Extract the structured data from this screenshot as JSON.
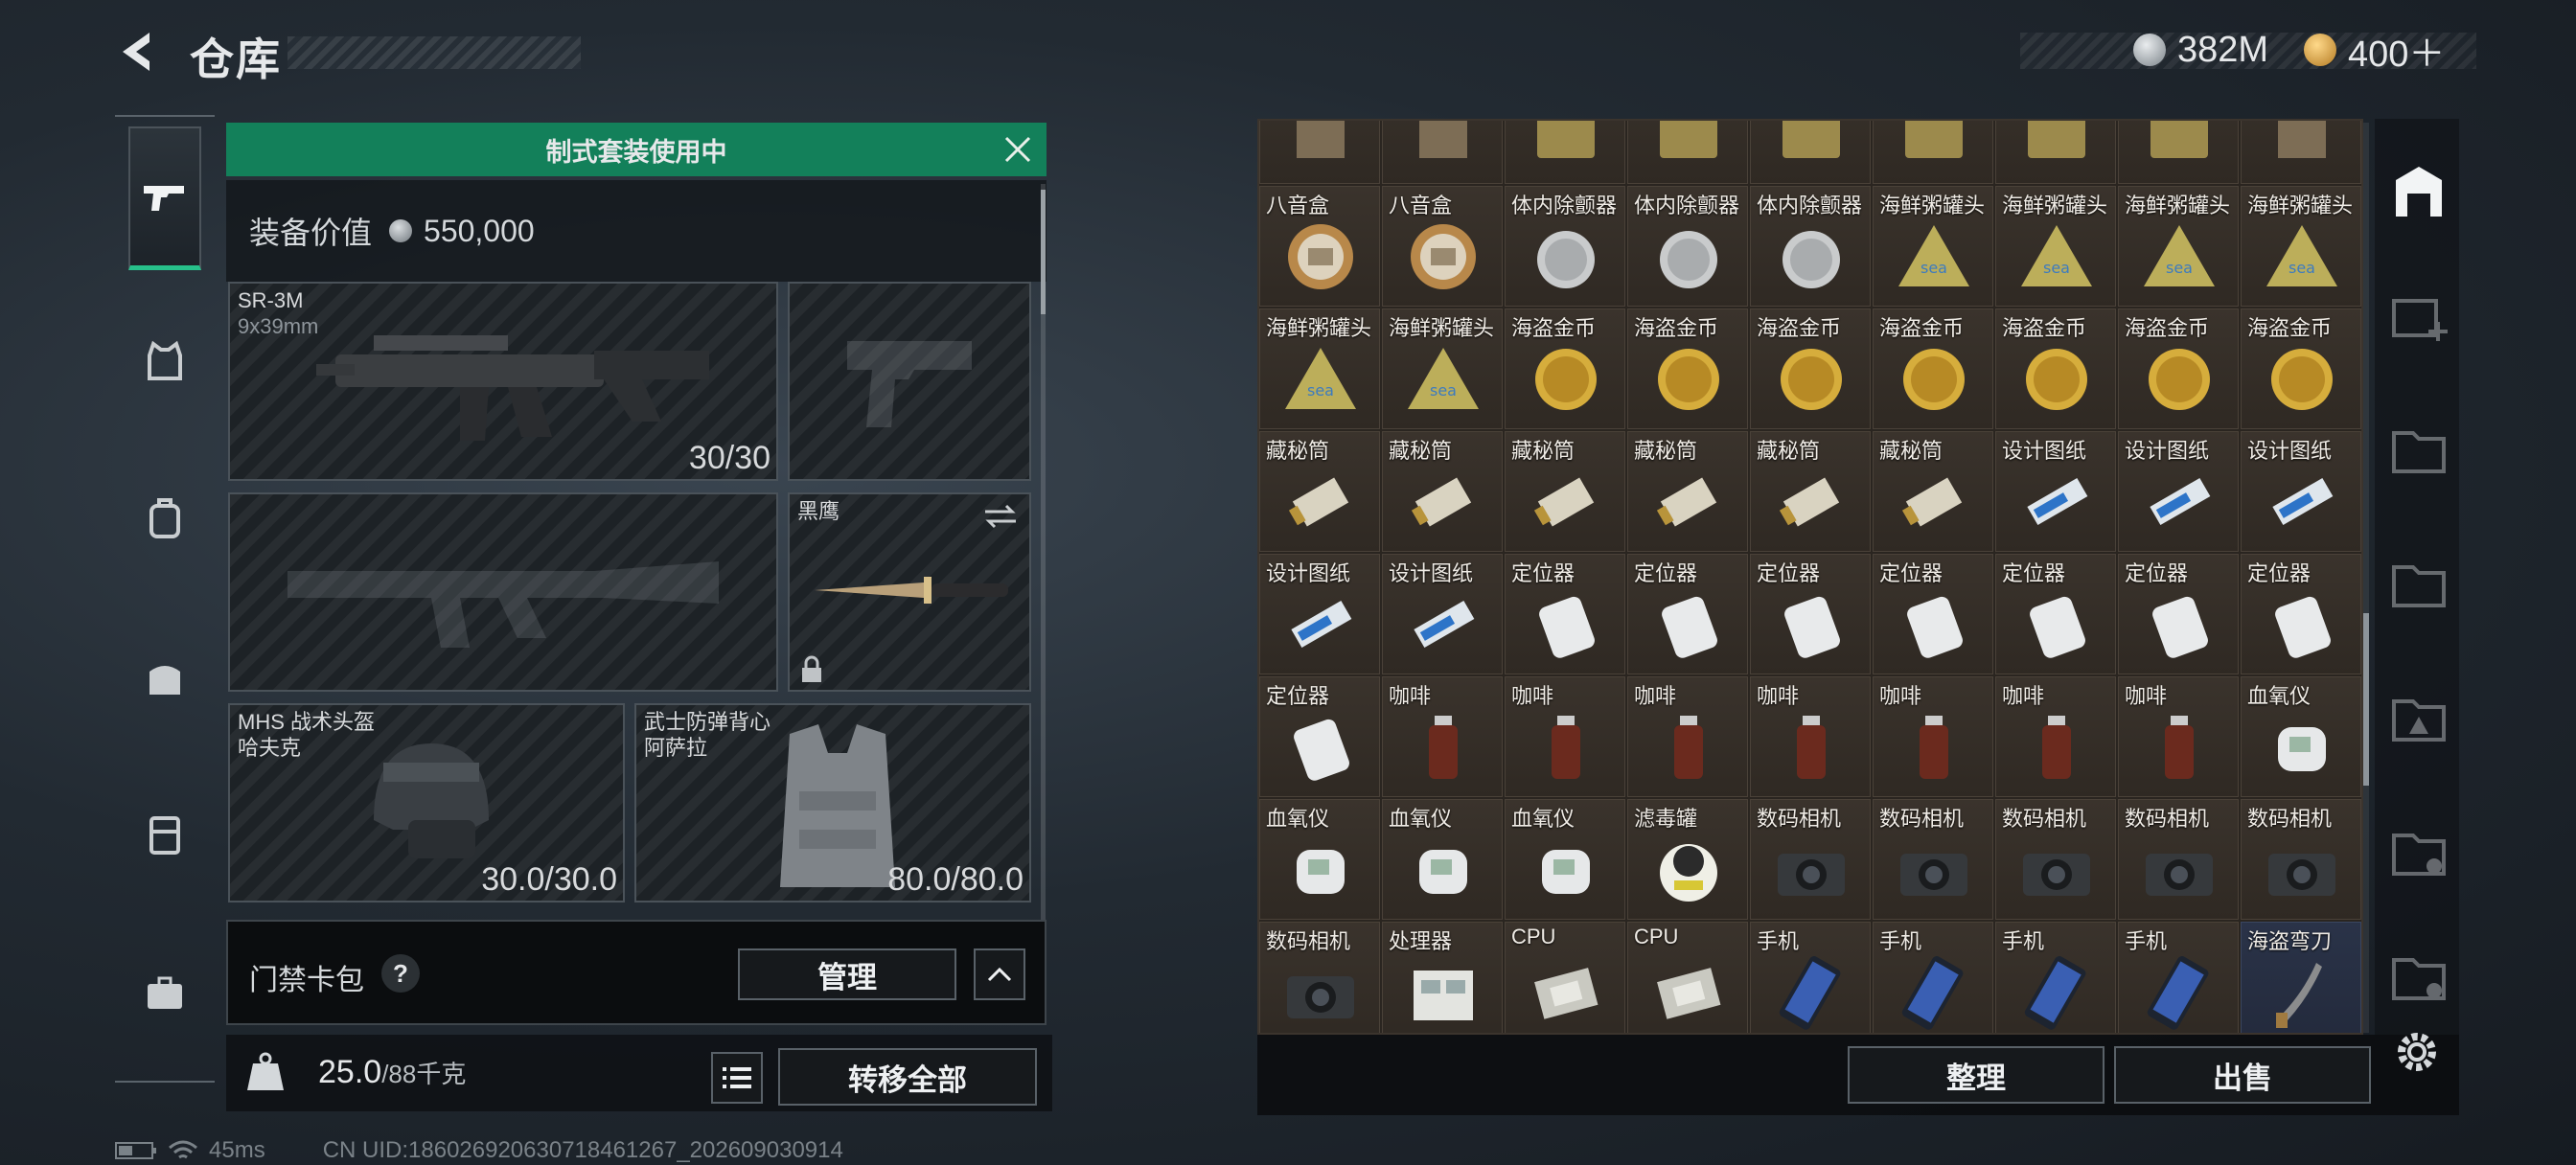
{
  "header": {
    "title": "仓库",
    "currencies": [
      {
        "icon": "silver-coin-icon",
        "value": "382M"
      },
      {
        "icon": "gold-coin-icon",
        "value": "400＋"
      }
    ]
  },
  "sidebar": {
    "items": [
      {
        "name": "weapon",
        "icon": "pistol-icon",
        "active": true
      },
      {
        "name": "armor",
        "icon": "vest-icon",
        "active": false
      },
      {
        "name": "backpack",
        "icon": "backpack-icon",
        "active": false
      },
      {
        "name": "bag",
        "icon": "bag-icon",
        "active": false
      },
      {
        "name": "chest-rig",
        "icon": "rig-icon",
        "active": false
      },
      {
        "name": "case",
        "icon": "briefcase-icon",
        "active": false
      }
    ]
  },
  "equipment": {
    "banner": "制式套装使用中",
    "value_label": "装备价值",
    "value": "550,000",
    "primary_weapon": {
      "name": "SR-3M",
      "caliber": "9x39mm",
      "ammo": "30/30"
    },
    "melee": {
      "name": "黑鹰"
    },
    "helmet": {
      "name": "MHS 战术头盔",
      "sub": "哈夫克",
      "durability": "30.0/30.0"
    },
    "vest": {
      "name": "武士防弹背心",
      "sub": "阿萨拉",
      "durability": "80.0/80.0"
    },
    "keycard_label": "门禁卡包",
    "keycard_help": "?",
    "manage_button": "管理",
    "weight_value": "25.0",
    "weight_max": "/88千克",
    "transfer_all_button": "转移全部"
  },
  "inventory": {
    "cells": [
      {
        "name": "",
        "icon": "item-icon",
        "blue": false
      },
      {
        "name": "",
        "icon": "item-icon",
        "blue": false
      },
      {
        "name": "",
        "icon": "can-icon",
        "blue": false
      },
      {
        "name": "",
        "icon": "can-icon",
        "blue": false
      },
      {
        "name": "",
        "icon": "can-icon",
        "blue": false
      },
      {
        "name": "",
        "icon": "can-icon",
        "blue": false
      },
      {
        "name": "",
        "icon": "can-icon",
        "blue": false
      },
      {
        "name": "",
        "icon": "can-icon",
        "blue": false
      },
      {
        "name": "",
        "icon": "item-icon",
        "blue": false
      },
      {
        "name": "八音盒",
        "icon": "music-box-icon",
        "blue": false
      },
      {
        "name": "八音盒",
        "icon": "music-box-icon",
        "blue": false
      },
      {
        "name": "体内除颤器",
        "icon": "defibrillator-icon",
        "blue": false
      },
      {
        "name": "体内除颤器",
        "icon": "defibrillator-icon",
        "blue": false
      },
      {
        "name": "体内除颤器",
        "icon": "defibrillator-icon",
        "blue": false
      },
      {
        "name": "海鲜粥罐头",
        "icon": "seafood-can-icon",
        "blue": false
      },
      {
        "name": "海鲜粥罐头",
        "icon": "seafood-can-icon",
        "blue": false
      },
      {
        "name": "海鲜粥罐头",
        "icon": "seafood-can-icon",
        "blue": false
      },
      {
        "name": "海鲜粥罐头",
        "icon": "seafood-can-icon",
        "blue": false
      },
      {
        "name": "海鲜粥罐头",
        "icon": "seafood-can-icon",
        "blue": false
      },
      {
        "name": "海鲜粥罐头",
        "icon": "seafood-can-icon",
        "blue": false
      },
      {
        "name": "海盗金币",
        "icon": "gold-coin-item-icon",
        "blue": false
      },
      {
        "name": "海盗金币",
        "icon": "gold-coin-item-icon",
        "blue": false
      },
      {
        "name": "海盗金币",
        "icon": "gold-coin-item-icon",
        "blue": false
      },
      {
        "name": "海盗金币",
        "icon": "gold-coin-item-icon",
        "blue": false
      },
      {
        "name": "海盗金币",
        "icon": "gold-coin-item-icon",
        "blue": false
      },
      {
        "name": "海盗金币",
        "icon": "gold-coin-item-icon",
        "blue": false
      },
      {
        "name": "海盗金币",
        "icon": "gold-coin-item-icon",
        "blue": false
      },
      {
        "name": "藏秘筒",
        "icon": "cryptex-icon",
        "blue": false
      },
      {
        "name": "藏秘筒",
        "icon": "cryptex-icon",
        "blue": false
      },
      {
        "name": "藏秘筒",
        "icon": "cryptex-icon",
        "blue": false
      },
      {
        "name": "藏秘筒",
        "icon": "cryptex-icon",
        "blue": false
      },
      {
        "name": "藏秘筒",
        "icon": "cryptex-icon",
        "blue": false
      },
      {
        "name": "藏秘筒",
        "icon": "cryptex-icon",
        "blue": false
      },
      {
        "name": "设计图纸",
        "icon": "blueprint-icon",
        "blue": false
      },
      {
        "name": "设计图纸",
        "icon": "blueprint-icon",
        "blue": false
      },
      {
        "name": "设计图纸",
        "icon": "blueprint-icon",
        "blue": false
      },
      {
        "name": "设计图纸",
        "icon": "blueprint-icon",
        "blue": false
      },
      {
        "name": "设计图纸",
        "icon": "blueprint-icon",
        "blue": false
      },
      {
        "name": "定位器",
        "icon": "locator-icon",
        "blue": false
      },
      {
        "name": "定位器",
        "icon": "locator-icon",
        "blue": false
      },
      {
        "name": "定位器",
        "icon": "locator-icon",
        "blue": false
      },
      {
        "name": "定位器",
        "icon": "locator-icon",
        "blue": false
      },
      {
        "name": "定位器",
        "icon": "locator-icon",
        "blue": false
      },
      {
        "name": "定位器",
        "icon": "locator-icon",
        "blue": false
      },
      {
        "name": "定位器",
        "icon": "locator-icon",
        "blue": false
      },
      {
        "name": "定位器",
        "icon": "locator-icon",
        "blue": false
      },
      {
        "name": "咖啡",
        "icon": "coffee-bottle-icon",
        "blue": false
      },
      {
        "name": "咖啡",
        "icon": "coffee-bottle-icon",
        "blue": false
      },
      {
        "name": "咖啡",
        "icon": "coffee-bottle-icon",
        "blue": false
      },
      {
        "name": "咖啡",
        "icon": "coffee-bottle-icon",
        "blue": false
      },
      {
        "name": "咖啡",
        "icon": "coffee-bottle-icon",
        "blue": false
      },
      {
        "name": "咖啡",
        "icon": "coffee-bottle-icon",
        "blue": false
      },
      {
        "name": "咖啡",
        "icon": "coffee-bottle-icon",
        "blue": false
      },
      {
        "name": "血氧仪",
        "icon": "oximeter-icon",
        "blue": false
      },
      {
        "name": "血氧仪",
        "icon": "oximeter-icon",
        "blue": false
      },
      {
        "name": "血氧仪",
        "icon": "oximeter-icon",
        "blue": false
      },
      {
        "name": "血氧仪",
        "icon": "oximeter-icon",
        "blue": false
      },
      {
        "name": "滤毒罐",
        "icon": "filter-canister-icon",
        "blue": false
      },
      {
        "name": "数码相机",
        "icon": "camera-icon",
        "blue": false
      },
      {
        "name": "数码相机",
        "icon": "camera-icon",
        "blue": false
      },
      {
        "name": "数码相机",
        "icon": "camera-icon",
        "blue": false
      },
      {
        "name": "数码相机",
        "icon": "camera-icon",
        "blue": false
      },
      {
        "name": "数码相机",
        "icon": "camera-icon",
        "blue": false
      },
      {
        "name": "数码相机",
        "icon": "camera-icon",
        "blue": false
      },
      {
        "name": "处理器",
        "icon": "processor-icon",
        "blue": false
      },
      {
        "name": "CPU",
        "icon": "cpu-icon",
        "blue": false
      },
      {
        "name": "CPU",
        "icon": "cpu-icon",
        "blue": false
      },
      {
        "name": "手机",
        "icon": "phone-icon",
        "blue": false
      },
      {
        "name": "手机",
        "icon": "phone-icon",
        "blue": false
      },
      {
        "name": "手机",
        "icon": "phone-icon",
        "blue": false
      },
      {
        "name": "手机",
        "icon": "phone-icon",
        "blue": false
      },
      {
        "name": "海盗弯刀",
        "icon": "cutlass-icon",
        "blue": true
      }
    ],
    "sort_button": "整理",
    "sell_button": "出售"
  },
  "status": {
    "ping": "45ms",
    "uid": "CN UID:18602692063071846126​7_202609030914"
  },
  "colors": {
    "accent_green": "#13805a",
    "panel_dark": "#1d2226",
    "inventory_bg": "#2a2520"
  }
}
